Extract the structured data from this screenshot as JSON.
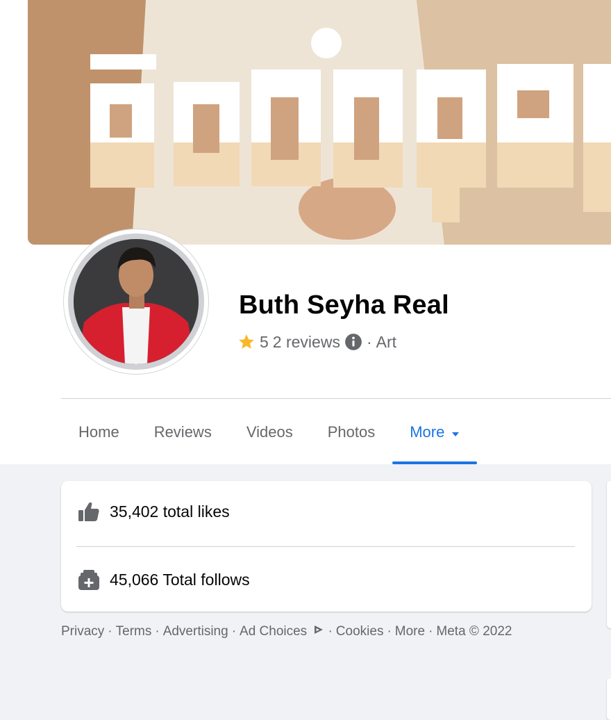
{
  "page": {
    "name": "Buth Seyha Real",
    "rating": "5",
    "reviews_text": "2 reviews",
    "separator": "·",
    "category": "Art"
  },
  "tabs": [
    {
      "label": "Home"
    },
    {
      "label": "Reviews"
    },
    {
      "label": "Videos"
    },
    {
      "label": "Photos"
    },
    {
      "label": "More"
    }
  ],
  "stats": {
    "likes": "35,402 total likes",
    "follows": "45,066 Total follows"
  },
  "footer": {
    "privacy": "Privacy",
    "terms": "Terms",
    "advertising": "Advertising",
    "ad_choices": "Ad Choices",
    "cookies": "Cookies",
    "more": "More",
    "meta": "Meta © 2022",
    "sep": "·"
  },
  "colors": {
    "accent": "#1b74e4",
    "star": "#f7b928",
    "secondary_text": "#65676b"
  }
}
